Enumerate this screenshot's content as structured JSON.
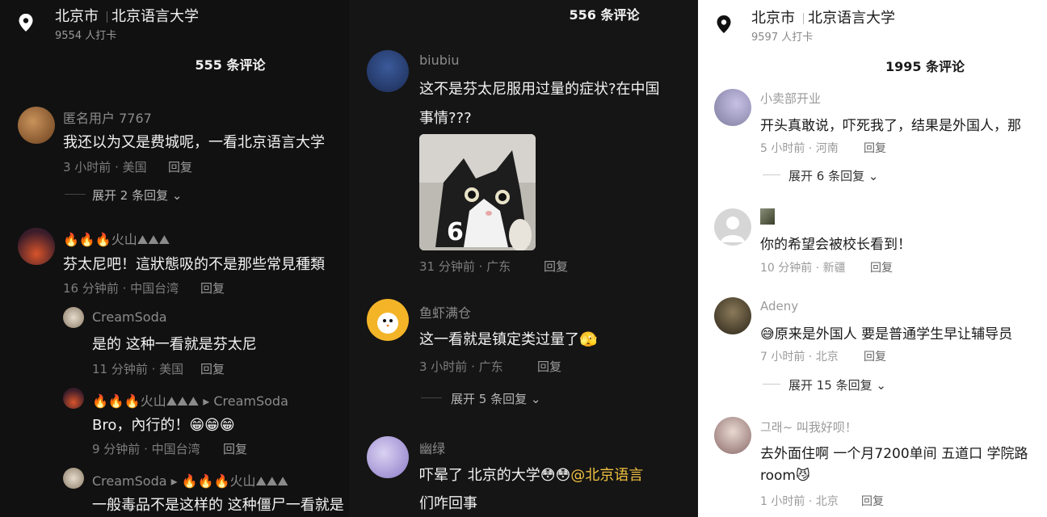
{
  "left": {
    "location": {
      "city": "北京市",
      "place": "北京语言大学",
      "checkins": "9554 人打卡"
    },
    "comment_count": "555 条评论",
    "comments": [
      {
        "user": "匿名用户 7767",
        "text": "我还以为又是费城呢，一看北京语言大学",
        "time": "3 小时前 · 美国",
        "reply": "回复",
        "expand": "展开 2 条回复"
      },
      {
        "user": "火山",
        "user_emoji": "🔥🔥🔥",
        "user_suffix": "⛰⛰⛰",
        "text": "芬太尼吧！這狀態吸的不是那些常見種類",
        "time": "16 分钟前 · 中国台湾",
        "reply": "回复"
      },
      {
        "user": "CreamSoda",
        "text": "是的 这种一看就是芬太尼",
        "time": "11 分钟前 · 美国",
        "reply": "回复"
      },
      {
        "user": "火山",
        "user_emoji": "🔥🔥🔥",
        "user_suffix": "⛰⛰⛰",
        "reply_to": "CreamSoda",
        "text": "Bro，內行的！😁😁😁",
        "time": "9 分钟前 · 中国台湾",
        "reply": "回复"
      },
      {
        "user": "CreamSoda",
        "reply_to": "🔥🔥🔥火山⛰⛰⛰",
        "text": "一般毒品不是这样的 这种僵尸一看就是"
      }
    ]
  },
  "middle": {
    "comment_count": "556 条评论",
    "comments": [
      {
        "user": "biubiu",
        "text_line1": "这不是芬太尼服用过量的症状?在中国",
        "text_line2": "事情???",
        "image_number": "6",
        "time": "31 分钟前 · 广东",
        "reply": "回复"
      },
      {
        "user": "鱼虾满仓",
        "text": "这一看就是镇定类过量了🫣",
        "time": "3 小时前 · 广东",
        "reply": "回复",
        "expand": "展开 5 条回复"
      },
      {
        "user": "幽绿",
        "text_line1": "吓晕了 北京的大学😳😳",
        "mention": "@北京语言",
        "text_line2": "们咋回事"
      }
    ]
  },
  "right": {
    "location": {
      "city": "北京市",
      "place": "北京语言大学",
      "checkins": "9597 人打卡"
    },
    "comment_count": "1995 条评论",
    "comments": [
      {
        "user": "小卖部开业",
        "text": "开头真敢说，吓死我了，结果是外国人，那",
        "time": "5 小时前 · 河南",
        "reply": "回复",
        "expand": "展开 6 条回复"
      },
      {
        "user": "",
        "text": "你的希望会被校长看到！",
        "time": "10 分钟前 · 新疆",
        "reply": "回复"
      },
      {
        "user": "Adeny",
        "text": "😅原来是外国人 要是普通学生早让辅导员",
        "time": "7 小时前 · 北京",
        "reply": "回复",
        "expand": "展开 15 条回复"
      },
      {
        "user": "그래~ 叫我好呗！",
        "text_line1": "去外面住啊 一个月7200单间 五道口 学院路",
        "text_line2": "room😼",
        "time": "1 小时前 · 北京",
        "reply": "回复"
      }
    ]
  },
  "colors": {
    "dark_bg": "#111111",
    "light_bg": "#ffffff",
    "mention": "#f0c040"
  }
}
